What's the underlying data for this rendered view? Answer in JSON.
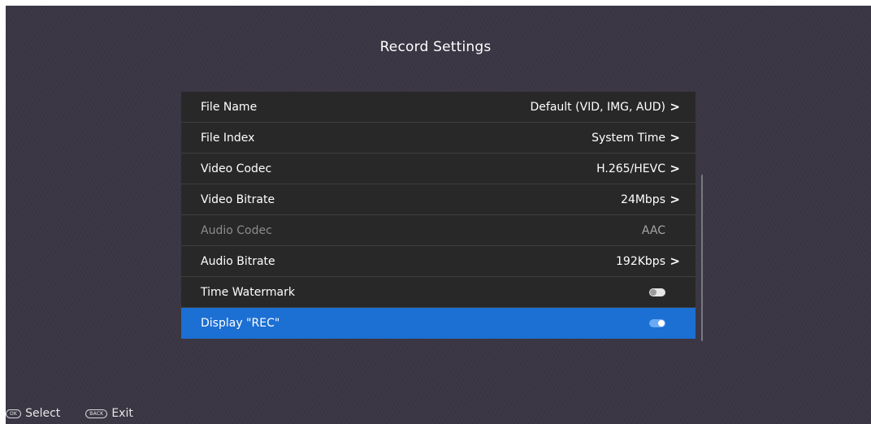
{
  "page": {
    "title": "Record Settings"
  },
  "settings": [
    {
      "label": "File Name",
      "value": "Default (VID, IMG, AUD)",
      "chevron": ">"
    },
    {
      "label": "File Index",
      "value": "System Time",
      "chevron": ">"
    },
    {
      "label": "Video Codec",
      "value": "H.265/HEVC",
      "chevron": ">"
    },
    {
      "label": "Video Bitrate",
      "value": "24Mbps",
      "chevron": ">"
    },
    {
      "label": "Audio Codec",
      "value": "AAC",
      "disabled": true
    },
    {
      "label": "Audio Bitrate",
      "value": "192Kbps",
      "chevron": ">"
    },
    {
      "label": "Time Watermark",
      "toggle": "off"
    },
    {
      "label": "Display \"REC\"",
      "toggle": "on",
      "selected": true
    }
  ],
  "footer": {
    "select_badge": "OK",
    "select_label": "Select",
    "exit_badge": "BACK",
    "exit_label": "Exit"
  },
  "colors": {
    "background": "#3a3644",
    "row": "#282828",
    "selected": "#1c6fd3",
    "disabled_text": "#8c8c8c"
  }
}
